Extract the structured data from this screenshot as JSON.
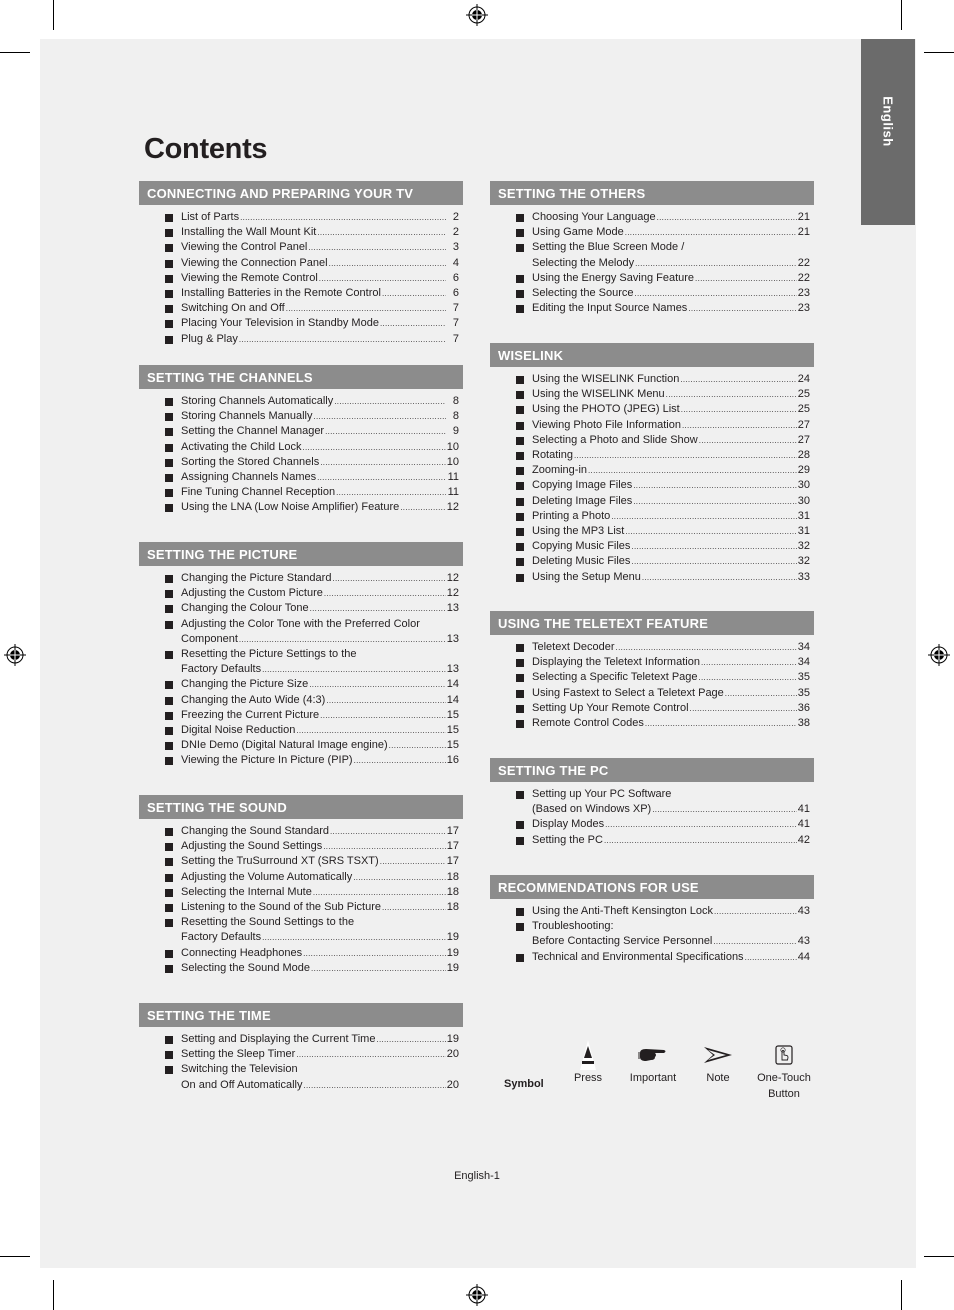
{
  "document": {
    "title": "Contents",
    "language_tab": "English",
    "footer_page": "English-1"
  },
  "left_column": [
    {
      "heading": "CONNECTING AND PREPARING YOUR TV",
      "items": [
        {
          "lines": [
            "List of Parts"
          ],
          "page": "2"
        },
        {
          "lines": [
            "Installing the Wall Mount Kit"
          ],
          "page": "2"
        },
        {
          "lines": [
            "Viewing the Control Panel"
          ],
          "page": "3"
        },
        {
          "lines": [
            "Viewing the Connection Panel"
          ],
          "page": "4"
        },
        {
          "lines": [
            "Viewing the Remote Control"
          ],
          "page": "6"
        },
        {
          "lines": [
            "Installing Batteries in the Remote Control"
          ],
          "page": "6"
        },
        {
          "lines": [
            "Switching On and Off"
          ],
          "page": "7"
        },
        {
          "lines": [
            "Placing Your Television in Standby Mode"
          ],
          "page": "7"
        },
        {
          "lines": [
            "Plug & Play"
          ],
          "page": "7"
        }
      ]
    },
    {
      "heading": "SETTING THE CHANNELS",
      "items": [
        {
          "lines": [
            "Storing Channels Automatically"
          ],
          "page": "8"
        },
        {
          "lines": [
            "Storing Channels Manually"
          ],
          "page": "8"
        },
        {
          "lines": [
            "Setting the Channel Manager"
          ],
          "page": "9"
        },
        {
          "lines": [
            "Activating the Child Lock"
          ],
          "page": "10"
        },
        {
          "lines": [
            "Sorting the Stored Channels"
          ],
          "page": "10"
        },
        {
          "lines": [
            "Assigning Channels Names"
          ],
          "page": "11"
        },
        {
          "lines": [
            "Fine Tuning Channel Reception"
          ],
          "page": "11"
        },
        {
          "lines": [
            "Using the LNA (Low Noise Amplifier) Feature"
          ],
          "page": "12"
        }
      ]
    },
    {
      "heading": "SETTING THE PICTURE",
      "items": [
        {
          "lines": [
            "Changing the Picture Standard"
          ],
          "page": "12"
        },
        {
          "lines": [
            "Adjusting the Custom Picture"
          ],
          "page": "12"
        },
        {
          "lines": [
            "Changing the Colour Tone"
          ],
          "page": "13"
        },
        {
          "lines": [
            "Adjusting the Color Tone with the Preferred Color",
            "Component"
          ],
          "page": "13"
        },
        {
          "lines": [
            "Resetting the Picture Settings to the",
            "Factory Defaults"
          ],
          "page": "13"
        },
        {
          "lines": [
            "Changing the Picture Size"
          ],
          "page": "14"
        },
        {
          "lines": [
            "Changing the Auto Wide (4:3)"
          ],
          "page": "14"
        },
        {
          "lines": [
            "Freezing the Current Picture"
          ],
          "page": "15"
        },
        {
          "lines": [
            "Digital Noise Reduction"
          ],
          "page": "15"
        },
        {
          "lines": [
            "DNIe Demo (Digital Natural Image engine)"
          ],
          "page": "15"
        },
        {
          "lines": [
            "Viewing the Picture In Picture (PIP)"
          ],
          "page": "16"
        }
      ]
    },
    {
      "heading": "SETTING THE SOUND",
      "items": [
        {
          "lines": [
            "Changing the Sound Standard"
          ],
          "page": "17"
        },
        {
          "lines": [
            "Adjusting the Sound Settings"
          ],
          "page": "17"
        },
        {
          "lines": [
            "Setting the TruSurround XT (SRS TSXT)"
          ],
          "page": "17"
        },
        {
          "lines": [
            "Adjusting the Volume Automatically"
          ],
          "page": "18"
        },
        {
          "lines": [
            "Selecting the Internal Mute"
          ],
          "page": "18"
        },
        {
          "lines": [
            "Listening to the Sound of the Sub Picture"
          ],
          "page": "18"
        },
        {
          "lines": [
            "Resetting the Sound Settings to the",
            "Factory Defaults"
          ],
          "page": "19"
        },
        {
          "lines": [
            "Connecting Headphones"
          ],
          "page": "19"
        },
        {
          "lines": [
            "Selecting the Sound Mode"
          ],
          "page": "19"
        }
      ]
    },
    {
      "heading": "SETTING THE TIME",
      "items": [
        {
          "lines": [
            "Setting and Displaying the Current Time"
          ],
          "page": "19"
        },
        {
          "lines": [
            "Setting the Sleep Timer"
          ],
          "page": "20"
        },
        {
          "lines": [
            "Switching the Television",
            "On and Off Automatically"
          ],
          "page": "20"
        }
      ]
    }
  ],
  "right_column": [
    {
      "heading": "SETTING THE OTHERS",
      "items": [
        {
          "lines": [
            "Choosing Your Language"
          ],
          "page": "21"
        },
        {
          "lines": [
            "Using Game Mode"
          ],
          "page": "21"
        },
        {
          "lines": [
            "Setting the Blue Screen Mode /",
            "Selecting the Melody"
          ],
          "page": "22"
        },
        {
          "lines": [
            "Using the Energy Saving Feature"
          ],
          "page": "22"
        },
        {
          "lines": [
            "Selecting the Source"
          ],
          "page": "23"
        },
        {
          "lines": [
            "Editing the Input Source Names"
          ],
          "page": "23"
        }
      ]
    },
    {
      "heading": "WISELINK",
      "items": [
        {
          "lines": [
            "Using the WISELINK Function"
          ],
          "page": "24"
        },
        {
          "lines": [
            "Using the WISELINK Menu"
          ],
          "page": "25"
        },
        {
          "lines": [
            "Using the PHOTO (JPEG) List"
          ],
          "page": "25"
        },
        {
          "lines": [
            "Viewing Photo File Information"
          ],
          "page": "27"
        },
        {
          "lines": [
            "Selecting a Photo and Slide Show"
          ],
          "page": "27"
        },
        {
          "lines": [
            "Rotating"
          ],
          "page": "28"
        },
        {
          "lines": [
            "Zooming-in"
          ],
          "page": "29"
        },
        {
          "lines": [
            "Copying Image Files"
          ],
          "page": "30"
        },
        {
          "lines": [
            "Deleting Image Files"
          ],
          "page": "30"
        },
        {
          "lines": [
            "Printing a Photo"
          ],
          "page": "31"
        },
        {
          "lines": [
            "Using the MP3 List"
          ],
          "page": "31"
        },
        {
          "lines": [
            "Copying Music Files"
          ],
          "page": "32"
        },
        {
          "lines": [
            "Deleting Music Files"
          ],
          "page": "32"
        },
        {
          "lines": [
            "Using the Setup Menu"
          ],
          "page": "33"
        }
      ]
    },
    {
      "heading": "USING THE TELETEXT FEATURE",
      "items": [
        {
          "lines": [
            "Teletext Decoder"
          ],
          "page": "34"
        },
        {
          "lines": [
            "Displaying the Teletext Information"
          ],
          "page": "34"
        },
        {
          "lines": [
            "Selecting a Specific Teletext Page"
          ],
          "page": "35"
        },
        {
          "lines": [
            "Using Fastext to Select a Teletext Page"
          ],
          "page": "35"
        },
        {
          "lines": [
            "Setting Up Your Remote Control"
          ],
          "page": "36"
        },
        {
          "lines": [
            "Remote Control Codes"
          ],
          "page": "38"
        }
      ]
    },
    {
      "heading": "SETTING THE PC",
      "items": [
        {
          "lines": [
            "Setting up Your PC Software",
            "(Based on Windows XP)"
          ],
          "page": "41"
        },
        {
          "lines": [
            "Display Modes"
          ],
          "page": "41"
        },
        {
          "lines": [
            "Setting the PC"
          ],
          "page": "42"
        }
      ]
    },
    {
      "heading": "RECOMMENDATIONS FOR USE",
      "items": [
        {
          "lines": [
            "Using the Anti-Theft Kensington Lock"
          ],
          "page": "43"
        },
        {
          "lines": [
            "Troubleshooting:",
            "Before Contacting Service Personnel"
          ],
          "page": "43"
        },
        {
          "lines": [
            "Technical and Environmental Specifications"
          ],
          "page": "44"
        }
      ]
    }
  ],
  "symbols": {
    "label": "Symbol",
    "items": [
      {
        "icon": "press-icon",
        "label_lines": [
          "Press"
        ]
      },
      {
        "icon": "pointing-hand-icon",
        "label_lines": [
          "Important"
        ]
      },
      {
        "icon": "note-arrow-icon",
        "label_lines": [
          "Note"
        ]
      },
      {
        "icon": "one-touch-button-icon",
        "label_lines": [
          "One-Touch",
          "Button"
        ]
      }
    ]
  },
  "colors": {
    "page_background": "#f0f0f0",
    "section_header": "#8c8c8c",
    "language_tab": "#6b6b6b",
    "text": "#231f20"
  }
}
